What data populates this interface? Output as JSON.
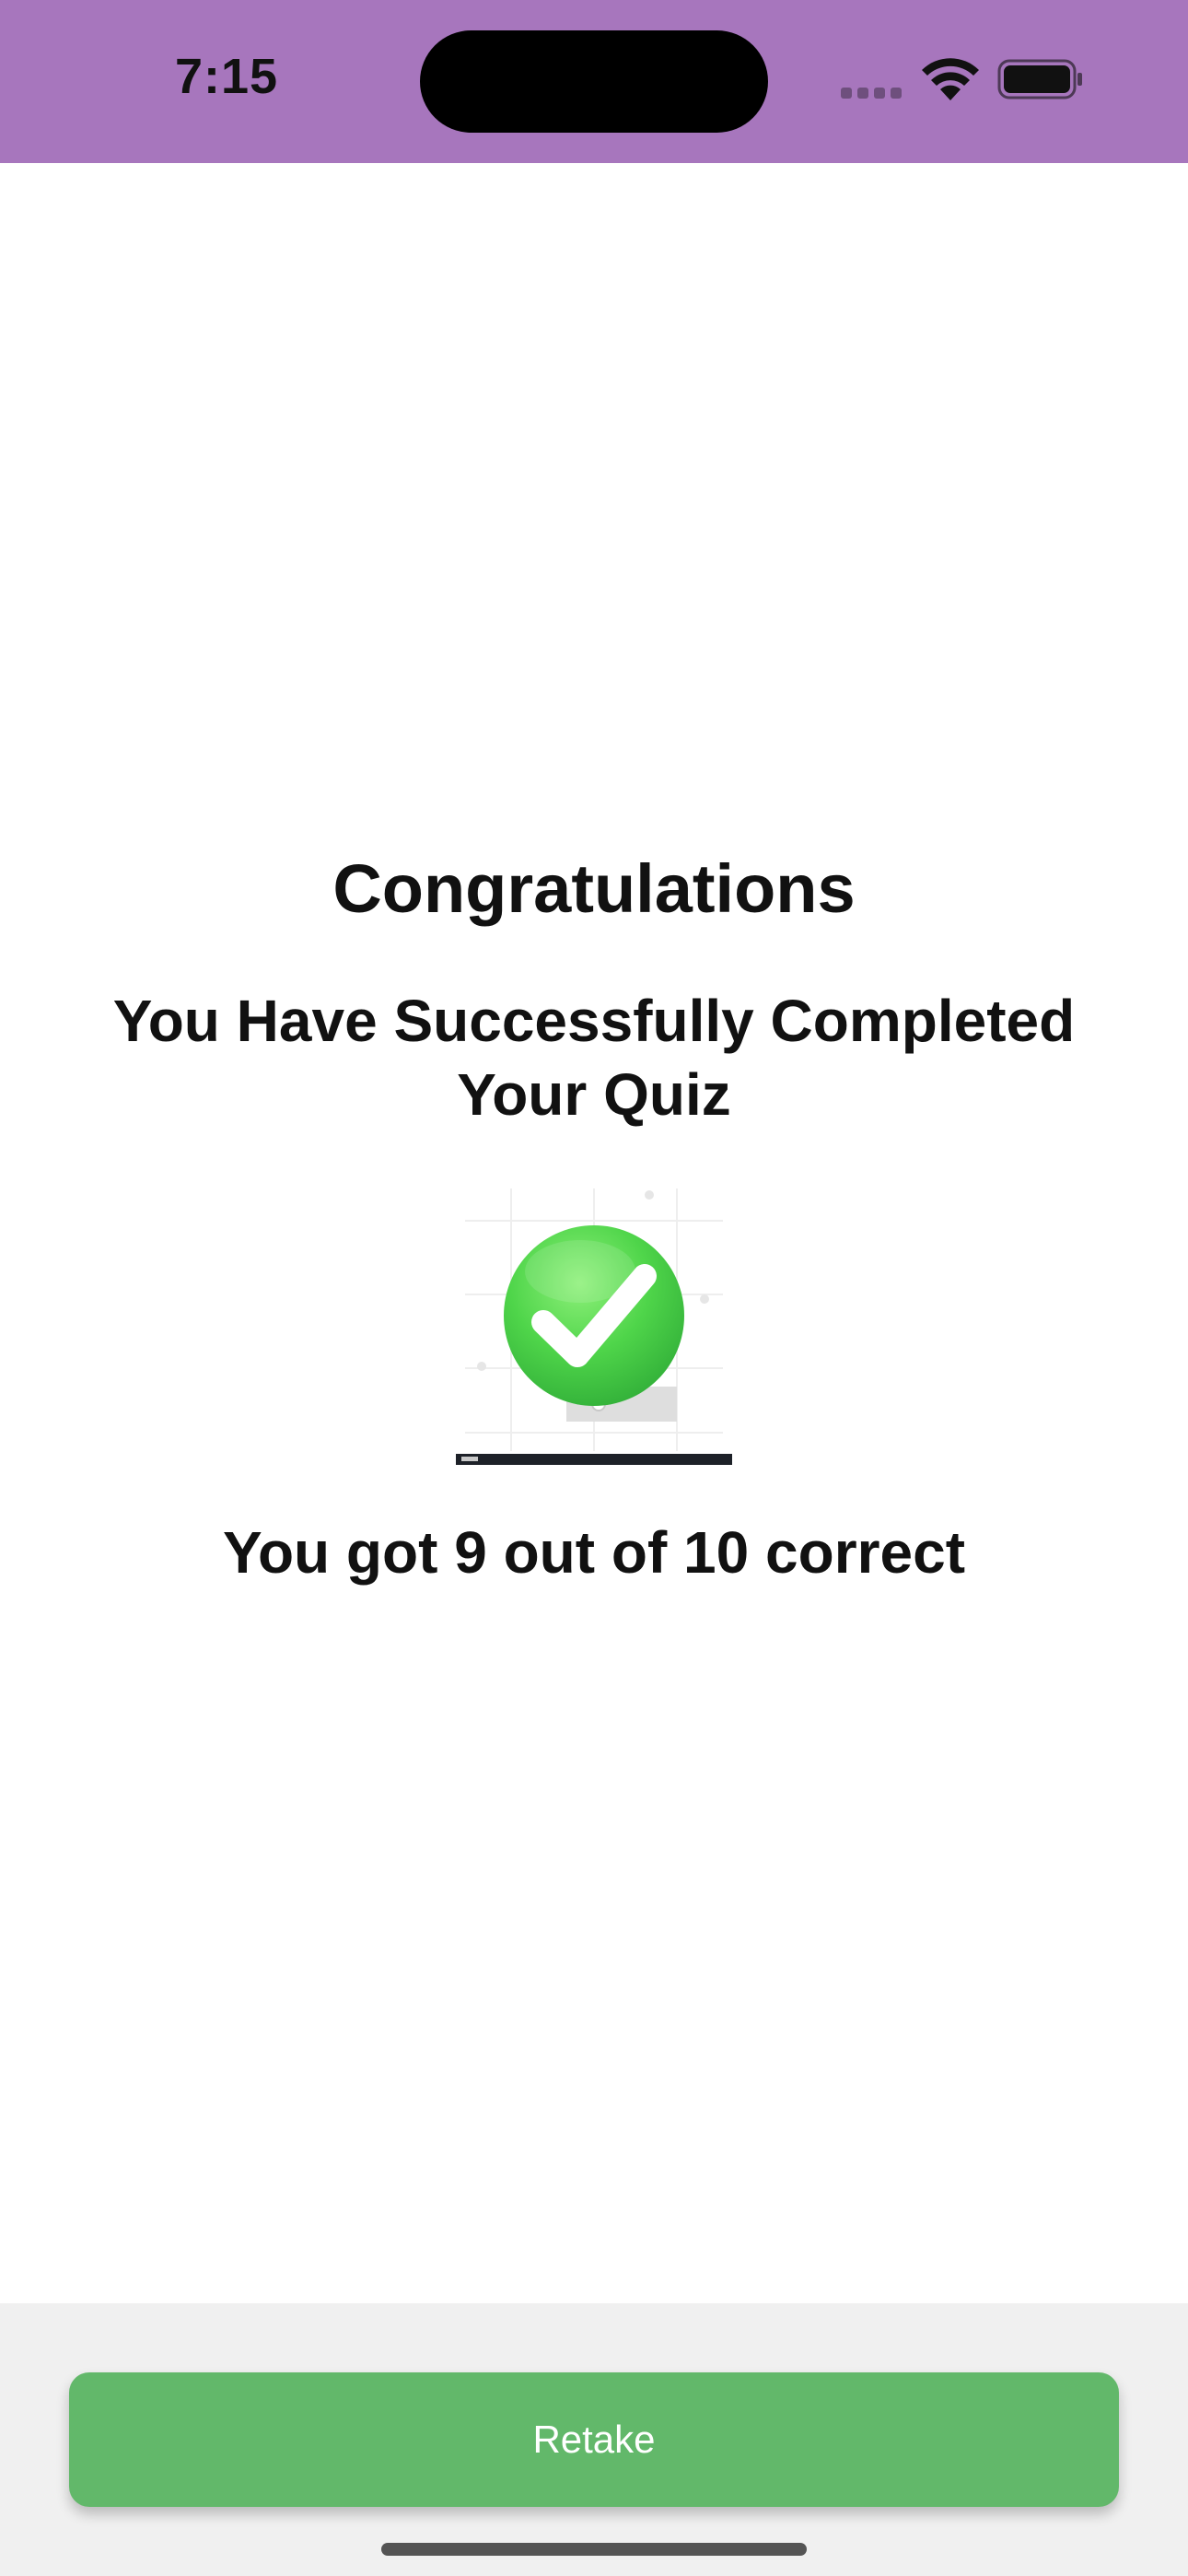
{
  "status_bar": {
    "time": "7:15",
    "background_color": "#a776bd",
    "icons": [
      "cellular-icon",
      "wifi-icon",
      "battery-icon"
    ]
  },
  "result": {
    "title": "Congratulations",
    "subtitle": "You Have Successfully Completed Your Quiz",
    "image_icon": "green-checkmark-icon",
    "score_text": "You got 9 out of 10 correct",
    "score": 9,
    "total": 10
  },
  "footer": {
    "retake_label": "Retake",
    "button_color": "#62b86a"
  }
}
